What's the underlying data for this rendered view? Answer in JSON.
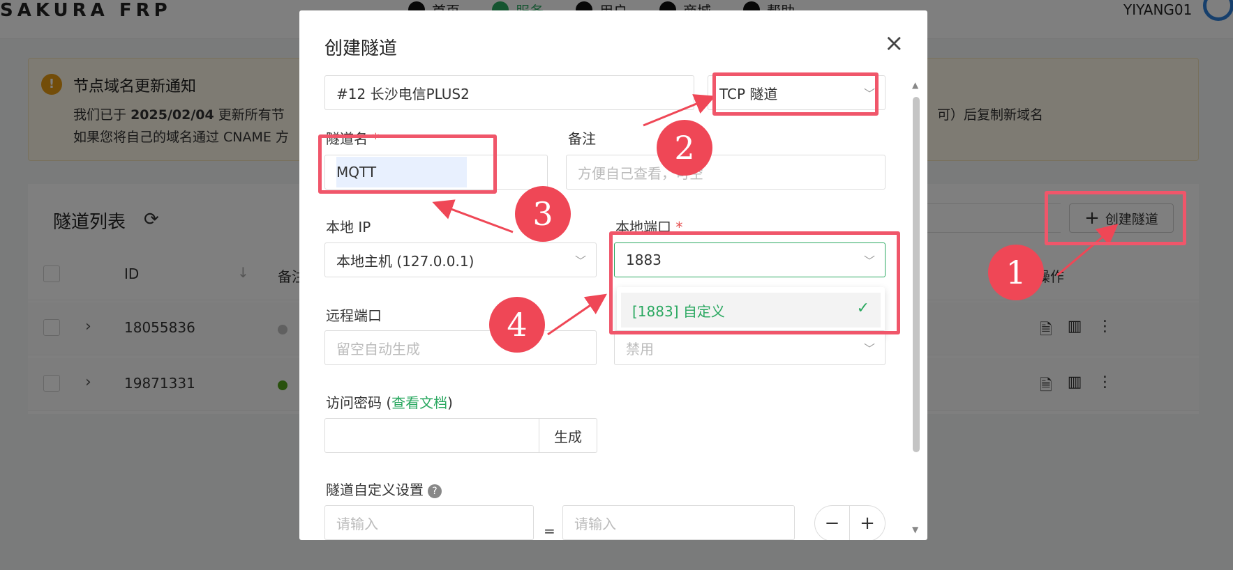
{
  "app": {
    "brand": "SAKURA FRP",
    "nav": [
      {
        "label": "首页",
        "icon": "home-icon"
      },
      {
        "label": "服务",
        "icon": "service-icon"
      },
      {
        "label": "用户",
        "icon": "user-icon"
      },
      {
        "label": "商城",
        "icon": "cart-icon"
      },
      {
        "label": "帮助",
        "icon": "help-icon"
      }
    ],
    "username": "YIYANG01"
  },
  "notice": {
    "title": "节点域名更新通知",
    "line1_prefix": "我们已于",
    "line1_date": "2025/02/04",
    "line1_suffix": "更新所有节",
    "line1_tail": "可）后复制新域名",
    "line2": "如果您将自己的域名通过 CNAME 方"
  },
  "tunnel_list": {
    "title": "隧道列表",
    "create_label": "创建隧道",
    "columns": {
      "id": "ID",
      "note": "备注",
      "ops": "操作"
    },
    "rows": [
      {
        "id": "18055836",
        "status_color": "#c0c0c0"
      },
      {
        "id": "19871331",
        "status_color": "#52a31a"
      }
    ]
  },
  "modal": {
    "title": "创建隧道",
    "node_value": "#12 长沙电信PLUS2",
    "type_value": "TCP 隧道",
    "name_label": "隧道名",
    "name_value": "MQTT",
    "note_label": "备注",
    "note_placeholder": "方便自己查看，可空",
    "local_ip_label": "本地 IP",
    "local_ip_value": "本地主机 (127.0.0.1)",
    "local_port_label": "本地端口",
    "local_port_value": "1883",
    "local_port_option": "[1883] 自定义",
    "remote_port_label": "远程端口",
    "remote_port_placeholder": "留空自动生成",
    "disabled_value": "禁用",
    "password_label_prefix": "访问密码 (",
    "password_doc_link": "查看文档",
    "password_label_suffix": ")",
    "generate_label": "生成",
    "custom_label": "隧道自定义设置",
    "custom_placeholder": "请输入",
    "equals": "=",
    "required_mark": "*"
  },
  "annotations": {
    "color": "#ef4756",
    "badges": [
      "1",
      "2",
      "3",
      "4"
    ]
  }
}
